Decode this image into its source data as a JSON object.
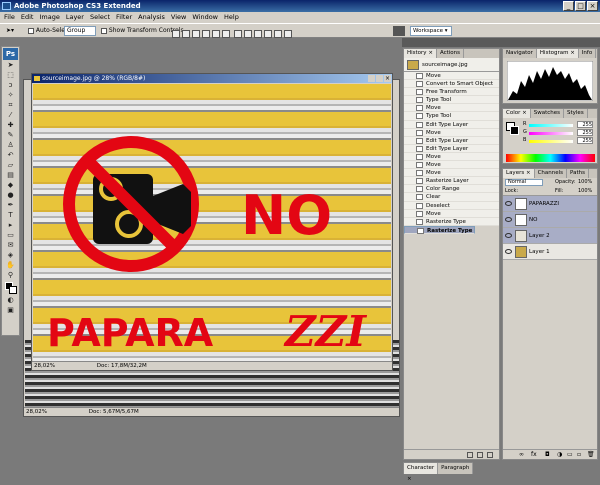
{
  "window": {
    "title": "Adobe Photoshop CS3 Extended"
  },
  "menu": [
    "File",
    "Edit",
    "Image",
    "Layer",
    "Select",
    "Filter",
    "Analysis",
    "View",
    "Window",
    "Help"
  ],
  "options": {
    "auto_select": "Auto-Select:",
    "auto_select_value": "Group",
    "show_transform": "Show Transform Controls",
    "workspace": "Workspace ▾"
  },
  "doc_front": {
    "title": "sourceimage.jpg @ 28% (RGB/8#)",
    "zoom": "28,02%",
    "doc": "Doc: 17,8M/32,2M"
  },
  "doc_back": {
    "zoom": "28,02%",
    "doc": "Doc: 5,67M/5,67M"
  },
  "artwork": {
    "word1": "NO",
    "word2": "PAPARA",
    "word3": "ZZI"
  },
  "history": {
    "tabs": [
      "History ×",
      "Actions"
    ],
    "snapshot": "sourceimage.jpg",
    "items": [
      "Move",
      "Convert to Smart Object",
      "Free Transform",
      "Type Tool",
      "Move",
      "Type Tool",
      "Edit Type Layer",
      "Move",
      "Edit Type Layer",
      "Edit Type Layer",
      "Move",
      "Move",
      "Move",
      "Rasterize Layer",
      "Color Range",
      "Clear",
      "Deselect",
      "Move",
      "Rasterize Type",
      "Rasterize Type"
    ],
    "selected_index": 19
  },
  "navigator": {
    "tabs": [
      "Navigator",
      "Histogram ×",
      "Info"
    ]
  },
  "color": {
    "tabs": [
      "Color ×",
      "Swatches",
      "Styles"
    ],
    "channels": [
      {
        "label": "R",
        "value": "255"
      },
      {
        "label": "G",
        "value": "255"
      },
      {
        "label": "B",
        "value": "255"
      }
    ]
  },
  "layers": {
    "tabs": [
      "Layers ×",
      "Channels",
      "Paths"
    ],
    "mode": "Normal",
    "opacity_label": "Opacity:",
    "opacity": "100%",
    "lock_label": "Lock:",
    "fill_label": "Fill:",
    "fill": "100%",
    "items": [
      {
        "name": "PAPARAZZI",
        "active": true
      },
      {
        "name": "NO",
        "active": true
      },
      {
        "name": "Layer 2",
        "active": true
      },
      {
        "name": "Layer 1",
        "active": false
      }
    ]
  },
  "bottom_tabs": [
    "Character ×",
    "Paragraph"
  ],
  "colors": {
    "accent": "#e30613",
    "yellow": "#e8c43a"
  }
}
